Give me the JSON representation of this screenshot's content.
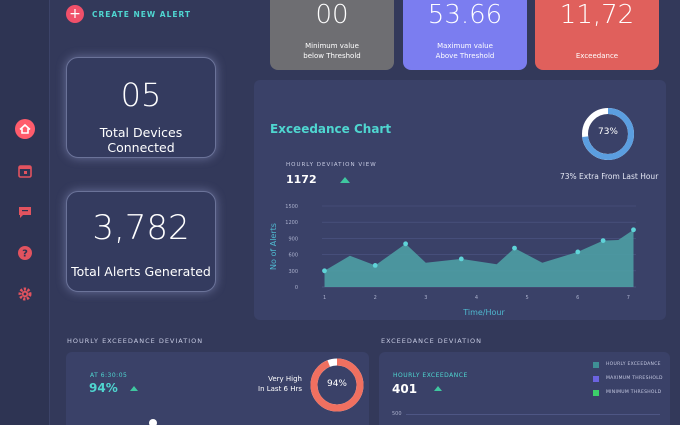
{
  "alert_button": {
    "label": "CREATE NEW ALERT",
    "icon": "plus-icon"
  },
  "sidebar": {
    "items": [
      {
        "name": "home",
        "icon": "home-icon",
        "active": true
      },
      {
        "name": "calendar",
        "icon": "calendar-icon"
      },
      {
        "name": "messages",
        "icon": "chat-icon"
      },
      {
        "name": "help",
        "icon": "help-icon"
      },
      {
        "name": "settings",
        "icon": "gear-icon"
      }
    ],
    "accent": "#ff5c6c"
  },
  "stats": {
    "devices": {
      "value": "05",
      "label": "Total Devices Connected"
    },
    "alerts": {
      "value": "3,782",
      "label": "Total Alerts Generated"
    }
  },
  "top_cards": [
    {
      "value": "00",
      "line1": "Minimum value",
      "line2": "below Threshold",
      "color": "#6e6e72"
    },
    {
      "value": "53.66",
      "line1": "Maximum value",
      "line2": "Above Threshold",
      "color": "#7b7df0"
    },
    {
      "value": "11,72",
      "line1": "Exceedance",
      "line2": "",
      "color": "#e0605c"
    }
  ],
  "exceedance": {
    "title": "Exceedance Chart",
    "donut_label": "73%",
    "donut_value": 0.73,
    "donut_caption": "73% Extra From Last Hour",
    "view_label": "HOURLY DEVIATION VIEW",
    "view_value": "1172"
  },
  "chart_data": {
    "type": "area",
    "x": [
      1,
      1.5,
      2,
      2.6,
      3,
      3.7,
      4.4,
      4.75,
      5.3,
      6,
      6.5,
      6.8,
      7.1
    ],
    "values": [
      300,
      580,
      400,
      800,
      450,
      520,
      420,
      720,
      450,
      650,
      860,
      870,
      1060
    ],
    "markers": [
      true,
      false,
      true,
      true,
      false,
      true,
      false,
      true,
      false,
      true,
      true,
      false,
      true
    ],
    "xticks": [
      "1",
      "2",
      "3",
      "4",
      "5",
      "6",
      "7"
    ],
    "yticks": [
      "0",
      "300",
      "600",
      "900",
      "1200",
      "1500"
    ],
    "ylim": [
      0,
      1500
    ],
    "xlim": [
      0.95,
      7.15
    ],
    "xlabel": "Time/Hour",
    "ylabel": "No of Alerts",
    "grid": true,
    "fill": "#4e9fa4",
    "marker_color": "#5fd3d8"
  },
  "deviation_left": {
    "section_title": "HOURLY EXCEEDANCE DEVIATION",
    "time_label": "AT 6:30:05",
    "value": "94%",
    "side_line1": "Very High",
    "side_line2": "In Last 6 Hrs",
    "donut_label": "94%",
    "donut_value": 0.94
  },
  "deviation_right": {
    "section_title": "EXCEEDANCE DEVIATION",
    "label": "HOURLY EXCEEDANCE",
    "value": "401",
    "axis_tick": "500",
    "legend": [
      {
        "label": "HOURLY EXCEEDANCE",
        "color": "#3f8f95"
      },
      {
        "label": "MAXIMUM THRESHOLD",
        "color": "#6b63e0"
      },
      {
        "label": "MINIMUM THRESHOLD",
        "color": "#3ccf6a"
      }
    ]
  }
}
